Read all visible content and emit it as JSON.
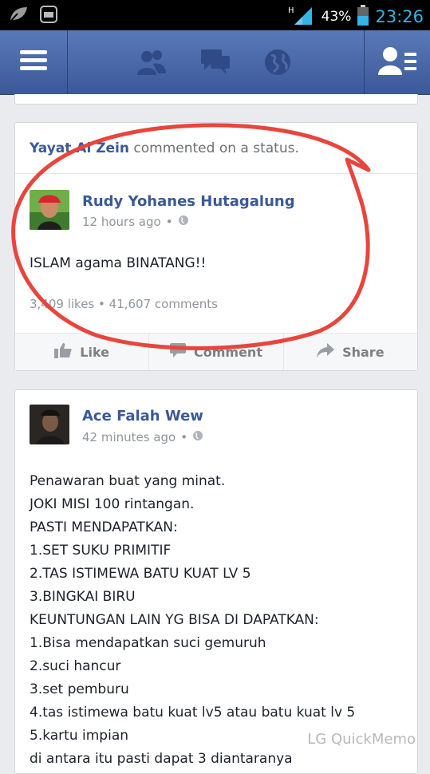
{
  "status_bar": {
    "battery_percent": "43%",
    "time": "23:26",
    "network": "H",
    "colors": {
      "clock": "#33b5e5"
    }
  },
  "topbar": {
    "icons": [
      "menu-icon",
      "friend-requests-icon",
      "messages-icon",
      "notifications-globe-icon",
      "friends-list-icon"
    ],
    "colors": {
      "bar": "#3b5998"
    }
  },
  "feed": {
    "story1": {
      "header_actor": "Yayat Al Zein",
      "header_text": " commented on a status.",
      "poster_name": "Rudy Yohanes Hutagalung",
      "time": "12 hours ago",
      "privacy_icon": "globe-icon",
      "text": "ISLAM agama BINATANG!!",
      "likes": "3,409 likes",
      "comments": "41,607 comments",
      "actions": {
        "like": "Like",
        "comment": "Comment",
        "share": "Share"
      }
    },
    "story2": {
      "poster_name": "Ace Falah Wew",
      "time": "42 minutes ago",
      "privacy_icon": "globe-icon",
      "lines": [
        "Penawaran buat yang minat.",
        "JOKI MISI 100 rintangan.",
        "PASTI MENDAPATKAN:",
        "1.SET SUKU PRIMITIF",
        "2.TAS ISTIMEWA BATU KUAT LV 5",
        "3.BINGKAI BIRU",
        "KEUNTUNGAN LAIN YG BISA DI DAPATKAN:",
        "1.Bisa mendapatkan suci gemuruh",
        "2.suci hancur",
        "3.set pemburu",
        "4.tas istimewa batu kuat lv5 atau batu kuat lv 5",
        "5.kartu impian",
        "di antara itu pasti dapat 3 diantaranya"
      ]
    }
  },
  "watermark": "LG QuickMemo",
  "annotation": {
    "shape": "hand-drawn circle",
    "color": "#e8453c"
  }
}
